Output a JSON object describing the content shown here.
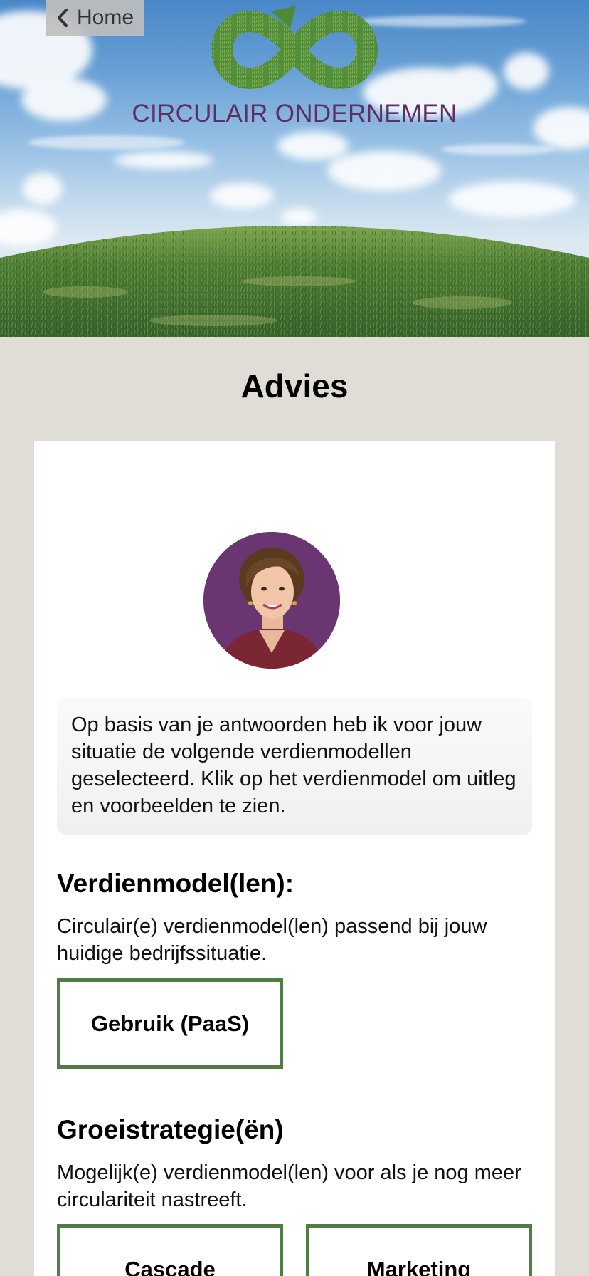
{
  "header": {
    "back_label": "Home",
    "brand_title": "CIRCULAIR ONDERNEMEN"
  },
  "page": {
    "title": "Advies"
  },
  "advice": {
    "text": "Op basis van je antwoorden heb ik voor jouw situatie de volgende verdienmodellen geselecteerd. Klik op het verdienmodel om uitleg en voorbeelden te zien."
  },
  "sections": [
    {
      "heading": "Verdienmodel(len):",
      "description": "Circulair(e) verdienmodel(len) passend bij jouw huidige bedrijfssituatie.",
      "buttons": [
        "Gebruik (PaaS)"
      ]
    },
    {
      "heading": "Groeistrategie(ën)",
      "description": "Mogelijk(e) verdienmodel(len) voor als je nog meer circulariteit nastreeft.",
      "buttons": [
        "Cascade",
        "Marketing"
      ]
    }
  ],
  "colors": {
    "brand_purple": "#5e2f63",
    "button_border_green": "#4f7d44",
    "page_background": "#e0ddd6"
  },
  "icons": {
    "back": "chevron-left-icon",
    "logo": "circular-infinity-logo"
  }
}
